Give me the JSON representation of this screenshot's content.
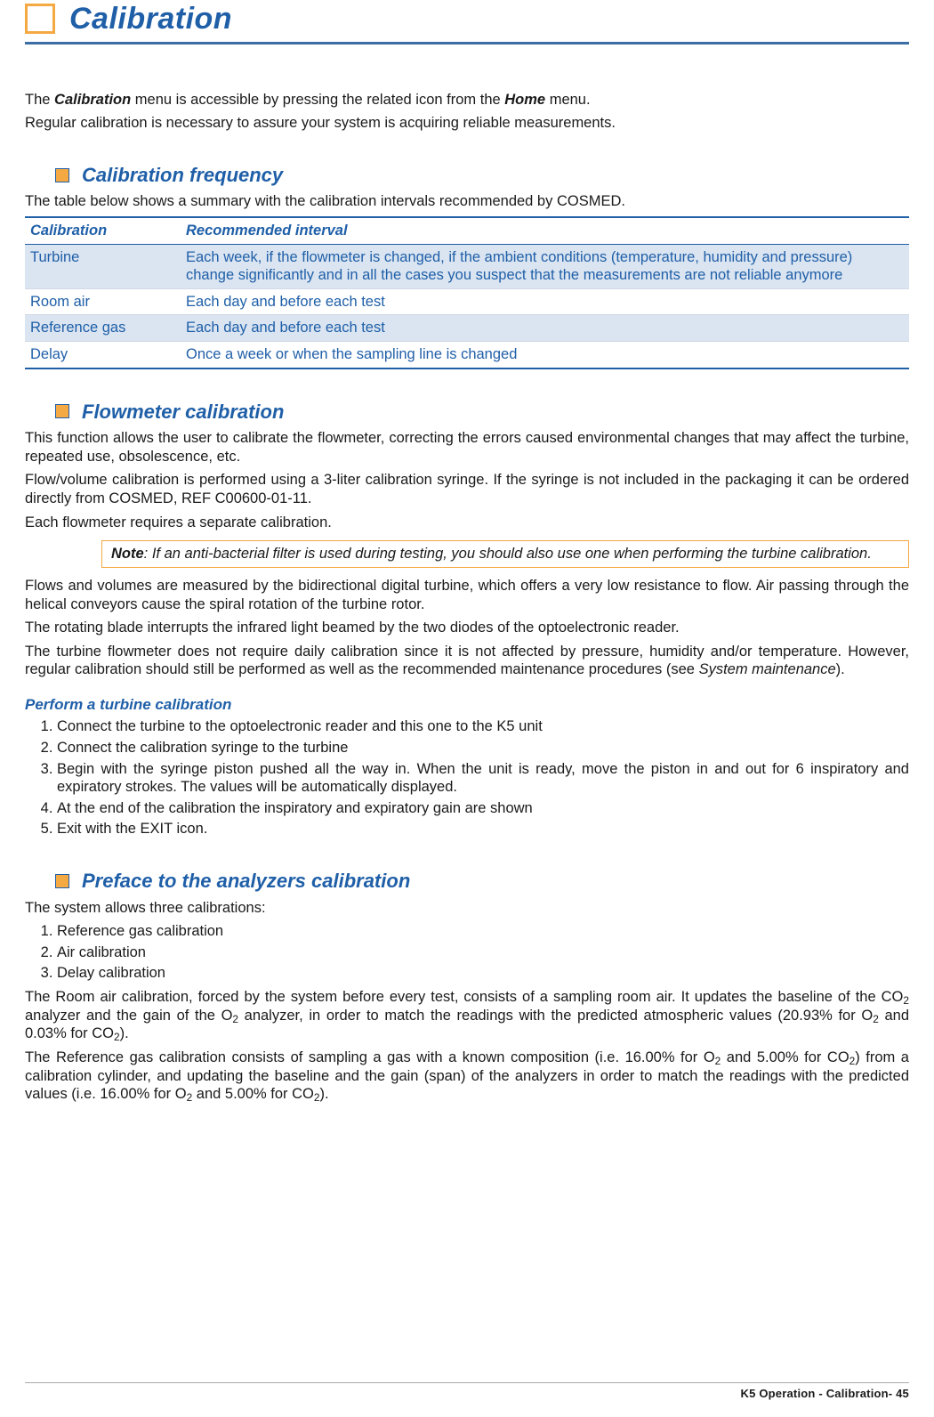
{
  "chapter": {
    "title": "Calibration"
  },
  "intro": {
    "p1a": "The ",
    "p1b_bold": "Calibration",
    "p1c": " menu is accessible by pressing the related icon from the ",
    "p1d_bold": "Home",
    "p1e": " menu.",
    "p2": "Regular calibration is necessary to assure your system is acquiring reliable measurements."
  },
  "freq": {
    "heading": "Calibration frequency",
    "lead": "The table below shows a summary with the calibration intervals recommended by COSMED.",
    "th0": "Calibration",
    "th1": "Recommended interval",
    "rows": [
      {
        "c0": "Turbine",
        "c1": "Each week, if the flowmeter is changed, if the ambient conditions (temperature, humidity and pressure) change significantly and in all the cases you suspect that the measurements are not reliable anymore",
        "shade": true
      },
      {
        "c0": "Room air",
        "c1": "Each day and before each test",
        "shade": false
      },
      {
        "c0": "Reference gas",
        "c1": "Each day and before each test",
        "shade": true
      },
      {
        "c0": "Delay",
        "c1": "Once a week or when the sampling line is changed",
        "shade": false
      }
    ]
  },
  "flow": {
    "heading": "Flowmeter calibration",
    "p1": "This function allows the user to calibrate the flowmeter, correcting the errors caused environmental changes that may affect the turbine, repeated use, obsolescence, etc.",
    "p2": "Flow/volume calibration is performed using a 3-liter calibration syringe. If the syringe is not included in the packaging it can be ordered directly from COSMED, REF C00600-01-11.",
    "p3": "Each flowmeter requires a separate calibration.",
    "note_label": "Note",
    "note_body": ": If an anti-bacterial filter is used during testing, you should also use one when performing the turbine calibration.",
    "p4": "Flows and volumes are measured by the bidirectional digital turbine, which offers a very low resistance to flow. Air passing through the helical conveyors cause the spiral rotation of the turbine rotor.",
    "p5": "The rotating blade interrupts the infrared light beamed by the two diodes of the optoelectronic reader.",
    "p6a": "The turbine flowmeter does not require daily calibration since it is not affected by pressure, humidity and/or temperature. However, regular calibration should still be performed as well as the recommended maintenance procedures (see ",
    "p6b_ital": "System maintenance",
    "p6c": ").",
    "subhead": "Perform a turbine calibration",
    "steps": [
      "Connect the turbine to the optoelectronic reader and this one to the K5 unit",
      "Connect the calibration syringe to the turbine",
      "Begin with the syringe piston pushed all the way in. When the unit is ready, move the piston in and out for 6 inspiratory and expiratory strokes. The values will be automatically displayed.",
      "At the end of the calibration the inspiratory and expiratory gain are shown",
      "Exit with the EXIT icon."
    ]
  },
  "preface": {
    "heading": "Preface to the analyzers calibration",
    "lead": "The system allows three calibrations:",
    "items": [
      "Reference gas calibration",
      "Air calibration",
      "Delay calibration"
    ],
    "p1": {
      "a": "The Room air calibration, forced by the system before every test, consists of a sampling room air. It updates the baseline of the CO",
      "b": " analyzer and the gain of the O",
      "c": " analyzer, in order to match the readings with the predicted atmospheric values (20.93% for O",
      "d": " and 0.03% for CO",
      "e": ")."
    },
    "p2": {
      "a": "The Reference gas calibration consists of sampling a gas with a known composition (i.e. 16.00% for O",
      "b": " and 5.00% for CO",
      "c": ") from a calibration cylinder, and updating the baseline and the gain (span) of the analyzers in order to match the readings with the predicted values (i.e. 16.00% for O",
      "d": " and 5.00% for CO",
      "e": ")."
    }
  },
  "footer": {
    "text": "K5 Operation - Calibration- 45"
  }
}
